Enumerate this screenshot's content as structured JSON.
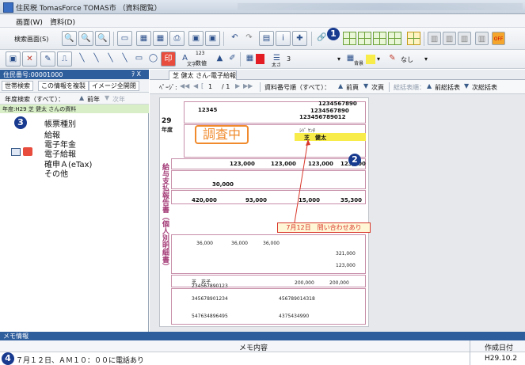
{
  "window": {
    "title": "住民税 TomasForce TOMAS市 （資料閲覧）"
  },
  "menu": {
    "items": [
      "画面(W)",
      "資料(D)"
    ]
  },
  "toolbar1": {
    "screen_search": "検索画面(S)"
  },
  "toolbar2": {
    "font_size_label": "文字",
    "num_label": "数値",
    "num_sup": "123",
    "thickness_label": "太さ",
    "thickness_value": "3",
    "background_label": "背景",
    "none_label": "なし"
  },
  "left_panel": {
    "title": "住民番号:00001000",
    "pin": "ｦ X",
    "tabs": [
      "世帯検索",
      "この情報を複製",
      "イメージ全開閉"
    ],
    "filter": "年度検索（すべて）：",
    "prev": "前年",
    "next": "次年",
    "year_line": "年度:H29 芝 健太 さんの資料",
    "list_header": "帳票種別",
    "items": [
      "給報",
      "電子年金",
      "電子給報",
      "確申Ａ(eTax)",
      "その他"
    ]
  },
  "doc": {
    "tab_label": "芝 健太 さん-電子給報",
    "page_label": "ﾍﾟｰｼﾞ:",
    "page_current": "1",
    "page_total": "/ 1",
    "order_label": "資料番号順（すべて）：",
    "prev_label": "前頁",
    "next_label": "次頁",
    "total_label": "総括表順：",
    "prev_total_label": "前総括表",
    "next_total_label": "次総括表"
  },
  "form": {
    "num_1234567890": "1234567890",
    "num_1234567890b": "1234567890",
    "num_12345678901": "123456789012",
    "code": "12345",
    "year": "29",
    "year_suffix": "年度",
    "name_kana": "ｼﾊﾞ ｹﾝﾀ",
    "name": "芝　健太",
    "stamp": "調査中",
    "amount1": "123,000",
    "amount2": "123,000",
    "amount3": "123,000",
    "amount4": "123,000",
    "amount5": "30,000",
    "amount6": "420,000",
    "amount7": "93,000",
    "amount8": "15,000",
    "amount9": "35,300",
    "side_title": "給与支払報告書（個人別明細書）",
    "note": "7月12日　問い合わせあり",
    "misc": [
      "36,000",
      "36,000",
      "36,000",
      "321,000",
      "321,000",
      "123,000",
      "200,000",
      "200,000"
    ],
    "person1": "芝　花子",
    "num_9": "234567890123",
    "ids": [
      "345678901234",
      "456789014318",
      "547634896495",
      "4375434990"
    ]
  },
  "memo": {
    "title": "メモ情報",
    "col_content": "メモ内容",
    "col_date": "作成日付",
    "row_content": "７月１２日、ＡＭ１０：００に電話あり",
    "row_date": "H29.10.2"
  },
  "callouts": [
    "1",
    "2",
    "3",
    "4"
  ],
  "colors": {
    "accent_blue": "#2f5e9d",
    "callout": "#183a8f",
    "stamp": "#f08a2c",
    "note_red": "#d9372b"
  }
}
